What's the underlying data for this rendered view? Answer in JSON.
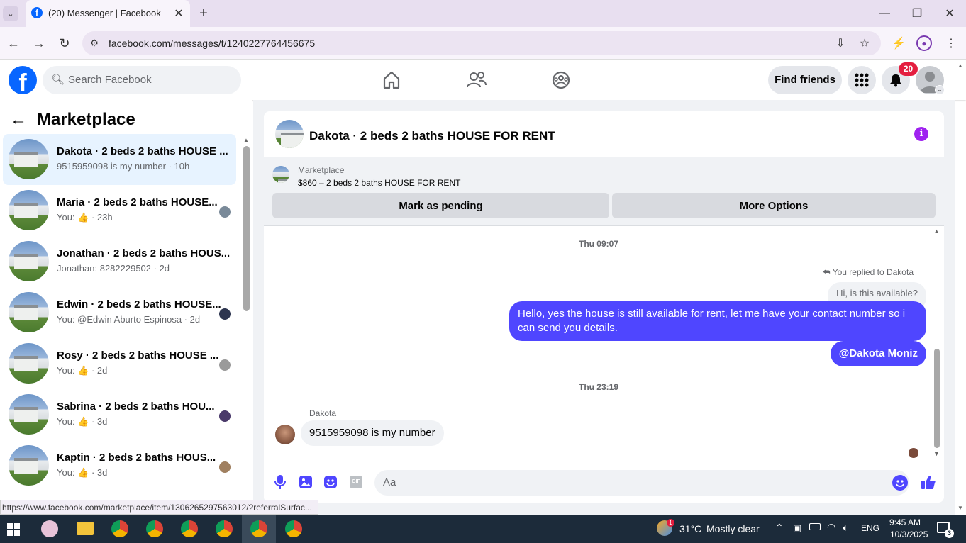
{
  "browser": {
    "tab_title": "(20) Messenger | Facebook",
    "url": "facebook.com/messages/t/1240227764456675",
    "status_url": "https://www.facebook.com/marketplace/item/1306265297563012/?referralSurfac..."
  },
  "header": {
    "search_placeholder": "Search Facebook",
    "find_friends": "Find friends",
    "notif_count": "20"
  },
  "left": {
    "title": "Marketplace",
    "conversations": [
      {
        "title": "Dakota · 2 beds 2 baths HOUSE ...",
        "sub": "9515959098 is my number · 10h",
        "mini": ""
      },
      {
        "title": "Maria · 2 beds 2 baths HOUSE...",
        "sub": "You: 👍 · 23h",
        "mini": "#7a8a99"
      },
      {
        "title": "Jonathan · 2 beds 2 baths HOUS...",
        "sub": "Jonathan: 8282229502 · 2d",
        "mini": ""
      },
      {
        "title": "Edwin · 2 beds 2 baths HOUSE...",
        "sub": "You: @Edwin Aburto Espinosa · 2d",
        "mini": "#2d3550"
      },
      {
        "title": "Rosy · 2 beds 2 baths HOUSE ...",
        "sub": "You: 👍 · 2d",
        "mini": "#9a9a9a"
      },
      {
        "title": "Sabrina · 2 beds 2 baths HOU...",
        "sub": "You: 👍 · 3d",
        "mini": "#4a3a6a"
      },
      {
        "title": "Kaptin · 2 beds 2 baths HOUS...",
        "sub": "You: 👍 · 3d",
        "mini": "#a08060"
      }
    ]
  },
  "chat": {
    "title": "Dakota · 2 beds 2 baths HOUSE FOR RENT",
    "listing_label": "Marketplace",
    "listing_price": "$860 – 2 beds 2 baths HOUSE FOR RENT",
    "btn_pending": "Mark as pending",
    "btn_more": "More Options",
    "time1": "Thu 09:07",
    "replied": "You replied to Dakota",
    "quoted": "Hi, is this available?",
    "msg1": "Hello, yes the house is still available for rent, let me have your contact number so i can send you details.",
    "msg2": "@Dakota Moniz",
    "time2": "Thu 23:19",
    "sender": "Dakota",
    "msg3": "9515959098 is my number",
    "composer_placeholder": "Aa"
  },
  "taskbar": {
    "temp": "31°C",
    "weather": "Mostly clear",
    "lang": "ENG",
    "time": "9:45 AM",
    "date": "10/3/2025",
    "weather_badge": "1",
    "notif_badge": "3"
  },
  "colors": {
    "accent": "#4f46ff",
    "fb_blue": "#0866ff",
    "purple": "#9f22f0"
  }
}
